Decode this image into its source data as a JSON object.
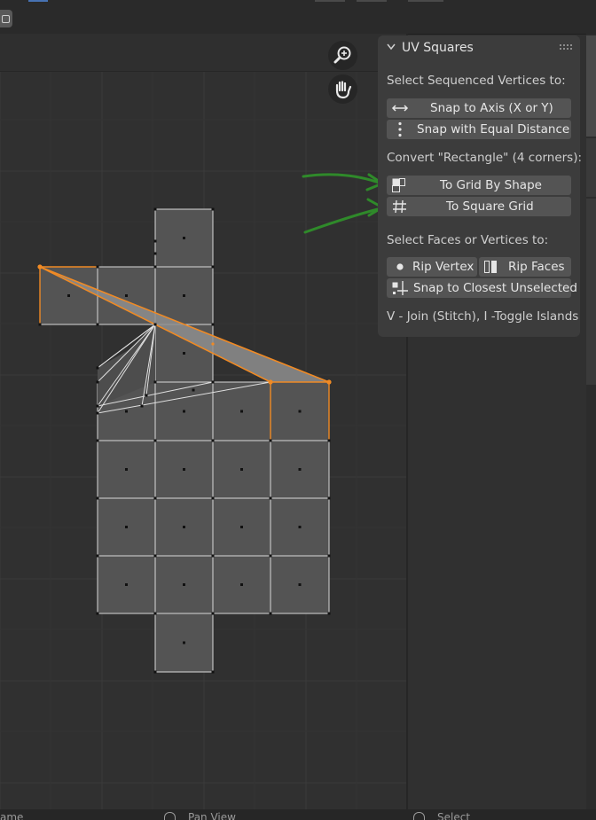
{
  "panel": {
    "title": "UV Squares",
    "sections": [
      {
        "heading": "Select Sequenced Vertices to:",
        "buttons": [
          {
            "label": "Snap to Axis (X or Y)",
            "icon": "horizontal-arrows-icon"
          },
          {
            "label": "Snap with Equal Distance",
            "icon": "vertical-dots-icon"
          }
        ]
      },
      {
        "heading": "Convert \"Rectangle\" (4 corners):",
        "buttons": [
          {
            "label": "To Grid By Shape",
            "icon": "grid-by-shape-icon"
          },
          {
            "label": "To Square Grid",
            "icon": "hash-grid-icon"
          }
        ]
      },
      {
        "heading": "Select Faces or Vertices to:",
        "buttons": [
          {
            "label": "Rip Vertex",
            "icon": "dot-icon"
          },
          {
            "label": "Rip Faces",
            "icon": "rip-faces-icon"
          },
          {
            "label": "Snap to Closest Unselected",
            "icon": "snap-closest-icon"
          }
        ]
      }
    ],
    "footer": "V - Join (Stitch), I -Toggle Islands"
  },
  "statusbar": {
    "hint_left": "ame",
    "hint_middle": "Pan View",
    "hint_right": "Select"
  },
  "navigation": {
    "zoom_icon": "zoom-icon",
    "pan_icon": "hand-icon"
  },
  "annotations": {
    "arrow_color": "#2f8a2a",
    "arrow_count": 2
  },
  "colors": {
    "background": "#303030",
    "panel": "#3c3c3c",
    "button": "#545454",
    "selection": "#f08a24",
    "face": "#545454",
    "edge": "#d8d8d8"
  }
}
